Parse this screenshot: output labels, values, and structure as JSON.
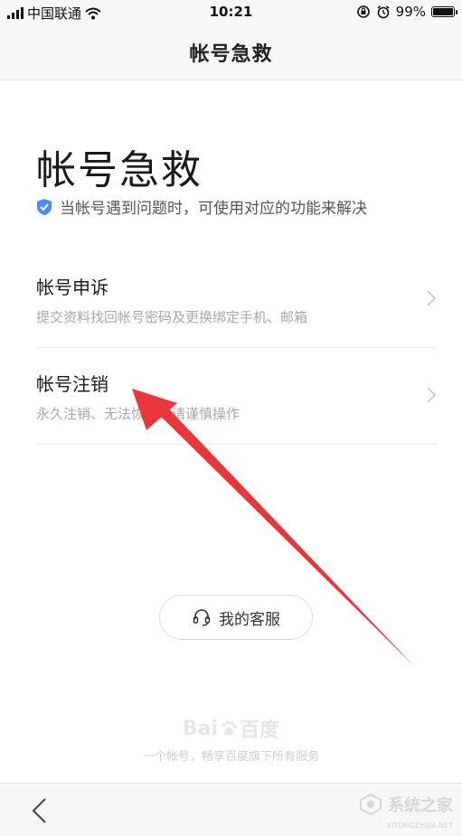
{
  "status_bar": {
    "carrier": "中国联通",
    "time": "10:21",
    "battery": "99%",
    "battery_level": 0.99
  },
  "nav": {
    "title": "帐号急救"
  },
  "header": {
    "title": "帐号急救",
    "subtitle": "当帐号遇到问题时，可使用对应的功能来解决",
    "shield_color": "#4a8cf0"
  },
  "menu": [
    {
      "label": "帐号申诉",
      "desc": "提交资料找回帐号密码及更换绑定手机、邮箱"
    },
    {
      "label": "帐号注销",
      "desc": "永久注销、无法恢复、请谨慎操作"
    }
  ],
  "service_button": {
    "label": "我的客服",
    "icon": "headset-icon"
  },
  "footer": {
    "logo_left": "Bai",
    "logo_right": "百度",
    "tagline": "一个帐号，畅享百度旗下所有服务"
  },
  "watermark": {
    "text": "系统之家",
    "url": "XITONGZHIJIA.NET"
  },
  "colors": {
    "arrow": "#e8363a",
    "accent": "#4a8cf0"
  }
}
